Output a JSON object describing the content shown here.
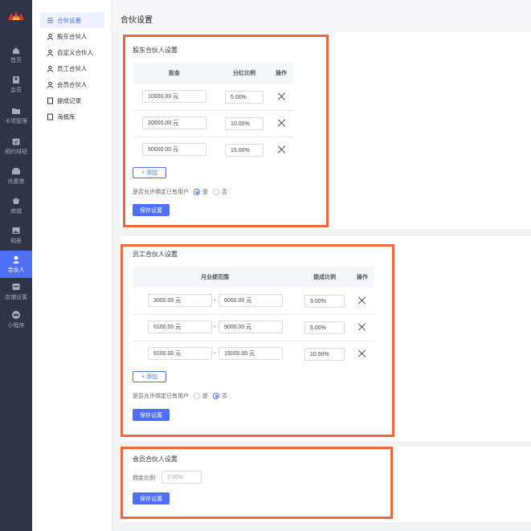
{
  "rail": {
    "items": [
      {
        "label": "首页",
        "icon": "home-icon"
      },
      {
        "label": "会员",
        "icon": "member-icon"
      },
      {
        "label": "卡项管理",
        "icon": "card-icon"
      },
      {
        "label": "预约排班",
        "icon": "calendar-icon"
      },
      {
        "label": "优惠券",
        "icon": "coupon-icon"
      },
      {
        "label": "商城",
        "icon": "shop-icon"
      },
      {
        "label": "相册",
        "icon": "album-icon"
      },
      {
        "label": "合伙人",
        "icon": "partner-icon"
      },
      {
        "label": "店铺设置",
        "icon": "store-icon"
      },
      {
        "label": "小程序",
        "icon": "miniprogram-icon"
      }
    ],
    "active_index": 7
  },
  "submenu": {
    "items": [
      {
        "label": "合伙设置",
        "icon": "settings-icon"
      },
      {
        "label": "股东合伙人",
        "icon": "person-icon"
      },
      {
        "label": "自定义合伙人",
        "icon": "person-icon"
      },
      {
        "label": "员工合伙人",
        "icon": "person-icon"
      },
      {
        "label": "会员合伙人",
        "icon": "person-icon"
      },
      {
        "label": "提成记录",
        "icon": "record-icon"
      },
      {
        "label": "海报库",
        "icon": "poster-icon"
      }
    ],
    "active_index": 0
  },
  "page": {
    "title": "合伙设置"
  },
  "shareholder": {
    "title": "股东合伙人设置",
    "columns": [
      "股金",
      "分红比例",
      "操作"
    ],
    "rows": [
      {
        "amount": "10000.00 元",
        "ratio": "5.00%"
      },
      {
        "amount": "20000.00 元",
        "ratio": "10.00%"
      },
      {
        "amount": "50000.00 元",
        "ratio": "15.00%"
      }
    ],
    "add_label": "+ 添加",
    "allow_label": "是否允许绑定已有用户",
    "yes_label": "是",
    "no_label": "否",
    "allow_selected": "yes",
    "save_label": "保存设置"
  },
  "staff": {
    "title": "员工合伙人设置",
    "columns": [
      "月业绩范围",
      "提成比例",
      "操作"
    ],
    "rows": [
      {
        "from": "3000.00 元",
        "to": "6000.00 元",
        "ratio": "3.00%"
      },
      {
        "from": "6100.00 元",
        "to": "9000.00 元",
        "ratio": "5.00%"
      },
      {
        "from": "9100.00 元",
        "to": "15000.00 元",
        "ratio": "10.00%"
      }
    ],
    "range_sep": "-",
    "add_label": "+ 添加",
    "allow_label": "是否允许绑定已有用户",
    "yes_label": "是",
    "no_label": "否",
    "allow_selected": "no",
    "save_label": "保存设置"
  },
  "member": {
    "title": "会员合伙人设置",
    "commission_label": "佣金比例",
    "commission_placeholder": "2.00%",
    "save_label": "保存设置"
  },
  "colors": {
    "accent": "#4d6ef7",
    "highlight": "#f0693a",
    "rail": "#2f3447"
  }
}
